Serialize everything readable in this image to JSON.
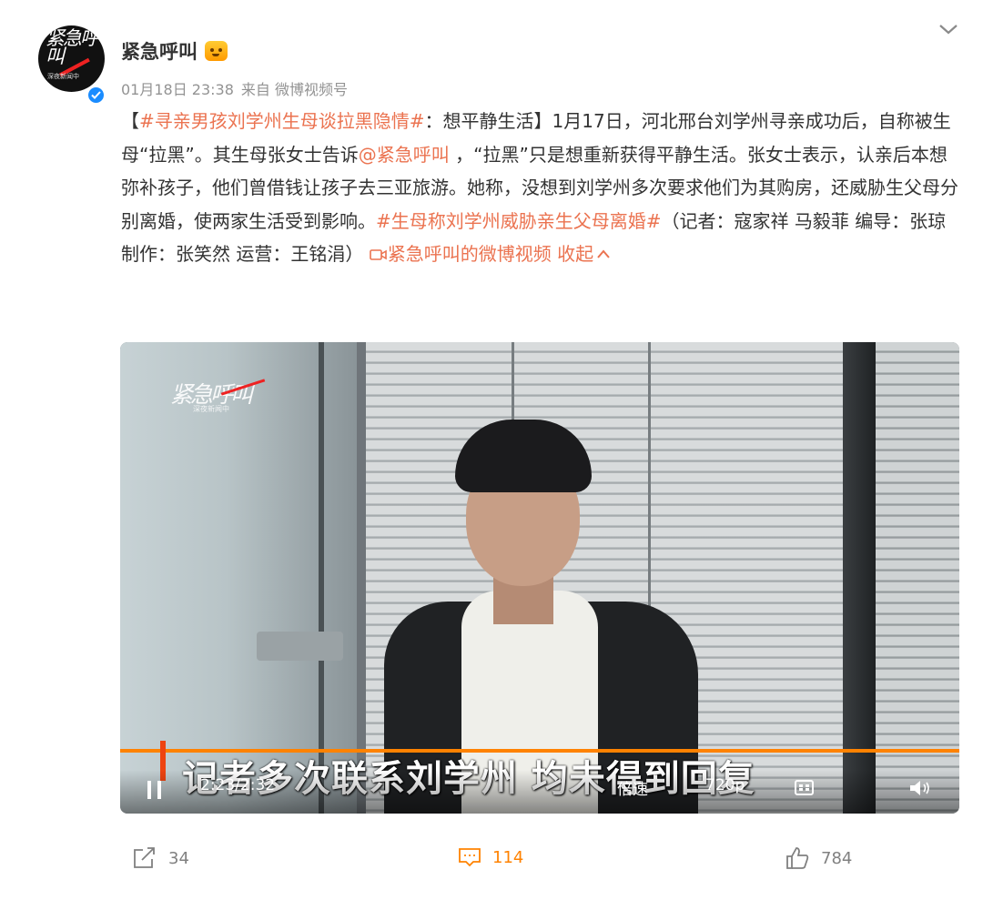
{
  "author": {
    "name": "紧急呼叫",
    "avatar_logo": "紧急呼叫",
    "avatar_tagline": "深夜新闻中",
    "verified_icon": "verified-check-icon",
    "badge_icon": "vip-emoji-badge"
  },
  "meta": {
    "timestamp": "01月18日 23:38",
    "source": "来自 微博视频号"
  },
  "post": {
    "segments": [
      {
        "text": "【",
        "type": "text"
      },
      {
        "text": "#寻亲男孩刘学州生母谈拉黑隐情#",
        "type": "link"
      },
      {
        "text": "：想平静生活】1月17日，河北邢台刘学州寻亲成功后，自称被生母“拉黑”。其生母张女士告诉",
        "type": "text"
      },
      {
        "text": "@紧急呼叫",
        "type": "link"
      },
      {
        "text": " ，“拉黑”只是想重新获得平静生活。张女士表示，认亲后本想弥补孩子，他们曾借钱让孩子去三亚旅游。她称，没想到刘学州多次要求他们为其购房，还威胁生父母分别离婚，使两家生活受到影响。",
        "type": "text"
      },
      {
        "text": "#生母称刘学州威胁亲生父母离婚#",
        "type": "link"
      },
      {
        "text": "（记者：寇家祥 马毅菲 编导：张琼 制作：张笑然 运营：王铭涓） ",
        "type": "text"
      },
      {
        "text": "紧急呼叫的微博视频",
        "type": "link",
        "icon": "video-icon"
      },
      {
        "text": " 收起",
        "type": "link",
        "icon": "chevron-up-icon"
      }
    ]
  },
  "video": {
    "watermark_logo": "紧急呼叫",
    "watermark_tag": "深夜新闻中",
    "subtitle": "记者多次联系刘学州 均未得到回复",
    "time": "2:23/2:32",
    "progress": 0.94,
    "speed_label": "倍速",
    "quality_label": "720p"
  },
  "actions": {
    "repost_count": "34",
    "comment_count": "114",
    "like_count": "784"
  },
  "colors": {
    "link": "#eb7350",
    "accent": "#ff8200",
    "meta": "#939393"
  }
}
